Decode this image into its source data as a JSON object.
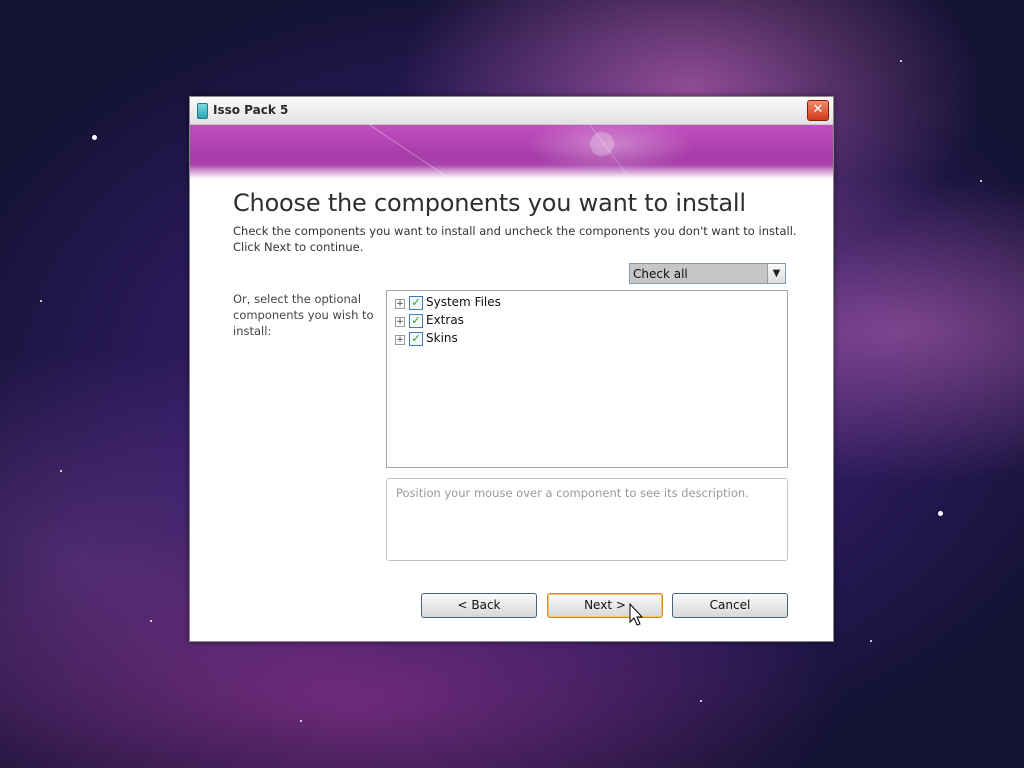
{
  "window": {
    "title": "Isso Pack 5"
  },
  "page": {
    "heading": "Choose the components you want to install",
    "description_line1": "Check the components you want to install and uncheck the components you don't want to install.",
    "description_line2": "Click Next to continue.",
    "side_label": "Or, select the optional components you wish to install:"
  },
  "install_type": {
    "selected": "Check all"
  },
  "components": [
    {
      "label": "System Files",
      "checked": true,
      "expander": "+"
    },
    {
      "label": "Extras",
      "checked": true,
      "expander": "+"
    },
    {
      "label": "Skins",
      "checked": true,
      "expander": "+"
    }
  ],
  "description_box": {
    "text": "Position your mouse over a component to see its description."
  },
  "buttons": {
    "back": "< Back",
    "next": "Next >",
    "cancel": "Cancel"
  },
  "icons": {
    "close": "close-icon",
    "check": "✓"
  },
  "colors": {
    "banner": "#b44bb4",
    "close_button": "#d33a1c"
  }
}
